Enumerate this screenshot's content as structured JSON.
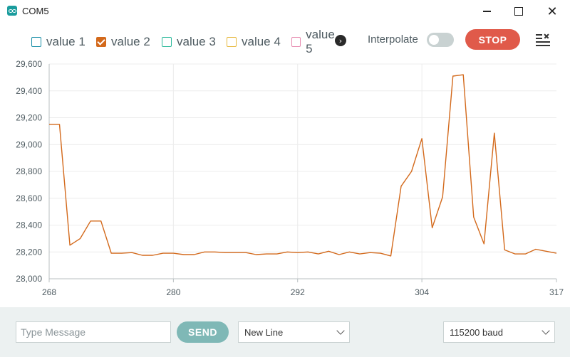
{
  "window": {
    "title": "COM5"
  },
  "legend": {
    "items": [
      {
        "label": "value 1",
        "checked": false,
        "color": "#1a8fa8"
      },
      {
        "label": "value 2",
        "checked": true,
        "color": "#d3691b"
      },
      {
        "label": "value 3",
        "checked": false,
        "color": "#2bb99b"
      },
      {
        "label": "value 4",
        "checked": false,
        "color": "#e6b83c"
      },
      {
        "label": "value 5",
        "checked": false,
        "color": "#e78bb0"
      }
    ],
    "more_icon": "chevron-right-icon"
  },
  "controls": {
    "interpolate_label": "Interpolate",
    "interpolate_on": false,
    "stop_label": "STOP",
    "clear_icon": "clear-list-icon"
  },
  "chart_data": {
    "type": "line",
    "title": "",
    "xlabel": "",
    "ylabel": "",
    "xlim": [
      268,
      317
    ],
    "ylim": [
      28000,
      29600
    ],
    "x_ticks": [
      "268",
      "280",
      "292",
      "304",
      "317"
    ],
    "y_ticks": [
      "28,000",
      "28,200",
      "28,400",
      "28,600",
      "28,800",
      "29,000",
      "29,200",
      "29,400",
      "29,600"
    ],
    "grid": true,
    "series": [
      {
        "name": "value 2",
        "color": "#d3691b",
        "x": [
          268,
          269,
          270,
          271,
          272,
          273,
          274,
          275,
          276,
          277,
          278,
          279,
          280,
          281,
          282,
          283,
          284,
          285,
          286,
          287,
          288,
          289,
          290,
          291,
          292,
          293,
          294,
          295,
          296,
          297,
          298,
          299,
          300,
          301,
          302,
          303,
          304,
          305,
          306,
          307,
          308,
          309,
          310,
          311,
          312,
          313,
          314,
          315,
          316,
          317
        ],
        "y": [
          29150,
          29150,
          28250,
          28300,
          28430,
          28430,
          28190,
          28190,
          28195,
          28175,
          28175,
          28190,
          28190,
          28180,
          28180,
          28200,
          28200,
          28195,
          28195,
          28195,
          28180,
          28185,
          28185,
          28200,
          28195,
          28200,
          28185,
          28205,
          28180,
          28200,
          28185,
          28195,
          28190,
          28170,
          28690,
          28800,
          29045,
          28380,
          28610,
          29510,
          29520,
          28460,
          28260,
          29085,
          28215,
          28185,
          28185,
          28220,
          28205,
          28190
        ]
      }
    ]
  },
  "bottom": {
    "message_placeholder": "Type Message",
    "message_value": "",
    "send_label": "SEND",
    "line_ending": "New Line",
    "baud": "115200 baud"
  }
}
